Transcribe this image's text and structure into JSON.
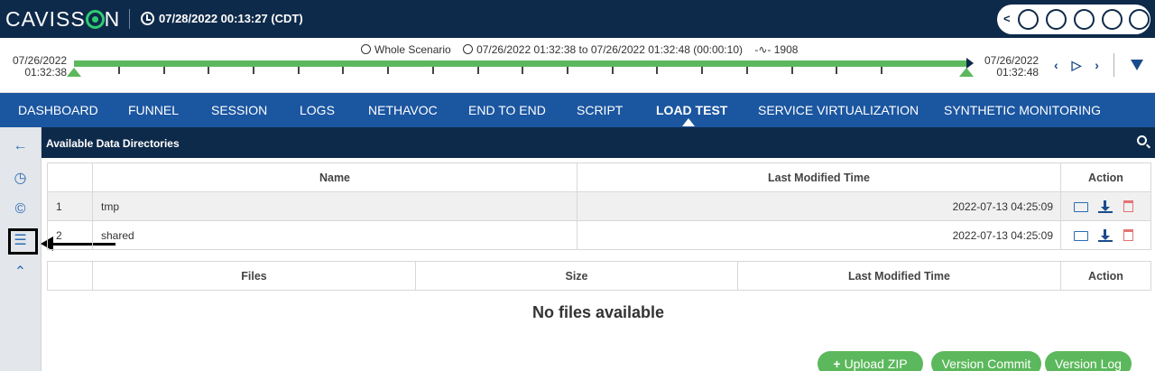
{
  "header": {
    "logo": "CAVISSON",
    "datetime": "07/28/2022 00:13:27 (CDT)",
    "icons": [
      "chevron-left-icon",
      "tools-icon",
      "bell-icon",
      "monitor-icon",
      "user-icon",
      "screen-icon"
    ]
  },
  "timeline": {
    "scenario": "Whole Scenario",
    "range": "07/26/2022 01:32:38 to 07/26/2022 01:32:48 (00:00:10)",
    "count": "1908",
    "start_date": "07/26/2022",
    "start_time": "01:32:38",
    "end_date": "07/26/2022",
    "end_time": "01:32:48",
    "nav": [
      "‹",
      "▷",
      "›"
    ]
  },
  "mainnav": {
    "items": [
      "DASHBOARD",
      "FUNNEL",
      "SESSION",
      "LOGS",
      "NETHAVOC",
      "END TO END",
      "SCRIPT",
      "LOAD TEST",
      "SERVICE VIRTUALIZATION",
      "SYNTHETIC MONITORING"
    ],
    "active": "LOAD TEST"
  },
  "sidebar": {
    "icons": [
      "back-arrow-icon",
      "clock-icon",
      "copyright-icon",
      "list-icon",
      "chevron-up-circle-icon"
    ]
  },
  "panel": {
    "title": "Available Data Directories"
  },
  "directories": {
    "headers": [
      "",
      "Name",
      "Last Modified Time",
      "Action"
    ],
    "rows": [
      {
        "num": "1",
        "name": "tmp",
        "time": "2022-07-13 04:25:09"
      },
      {
        "num": "2",
        "name": "shared",
        "time": "2022-07-13 04:25:09"
      }
    ]
  },
  "files": {
    "headers": [
      "",
      "Files",
      "Size",
      "Last Modified Time",
      "Action"
    ],
    "empty": "No files available"
  },
  "buttons": {
    "upload": "Upload ZIP",
    "commit": "Version Commit",
    "log": "Version Log"
  },
  "colors": {
    "header_bg": "#0e2a4a",
    "nav_bg": "#1b56a0",
    "accent_green": "#5cb85c"
  }
}
